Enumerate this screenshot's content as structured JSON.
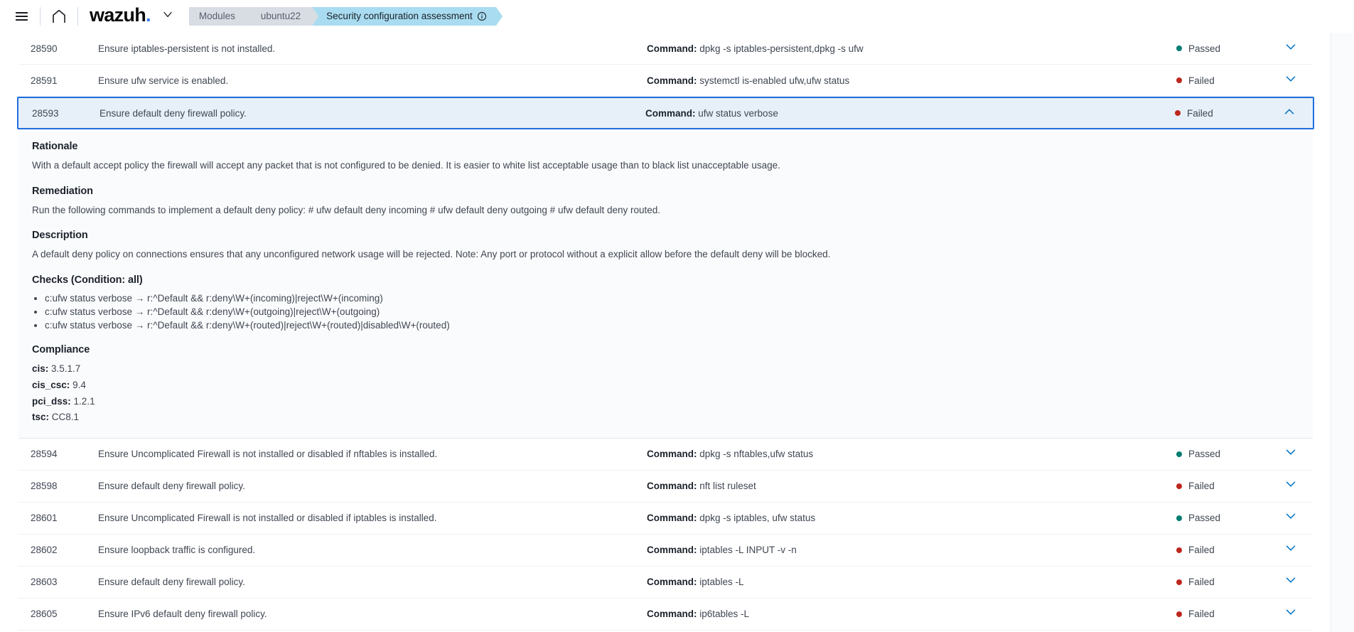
{
  "header": {
    "menu_icon": "hamburger-menu-icon",
    "home_icon": "home-icon",
    "brand": "wazuh",
    "brand_dot": ".",
    "brand_caret_icon": "chevron-down-icon",
    "breadcrumbs": [
      {
        "label": "Modules",
        "active": false
      },
      {
        "label": "ubuntu22",
        "active": false
      },
      {
        "label": "Security configuration assessment",
        "active": true,
        "info_icon": "info-circle-icon"
      }
    ]
  },
  "colors": {
    "passed": "#017d73",
    "failed": "#bd271e",
    "selected_border": "#1f6fde",
    "selected_bg": "#e7f0f8",
    "breadcrumb_active_bg": "#a9dcf0",
    "brand_dot": "#2f7ded",
    "caret": "#0071c2"
  },
  "table": {
    "command_label": "Command:",
    "rows": [
      {
        "id": "28590",
        "title": "Ensure iptables-persistent is not installed.",
        "command": "dpkg -s iptables-persistent,dpkg -s ufw",
        "status": "Passed",
        "expanded": false
      },
      {
        "id": "28591",
        "title": "Ensure ufw service is enabled.",
        "command": "systemctl is-enabled ufw,ufw status",
        "status": "Failed",
        "expanded": false
      },
      {
        "id": "28593",
        "title": "Ensure default deny firewall policy.",
        "command": "ufw status verbose",
        "status": "Failed",
        "expanded": true
      },
      {
        "id": "28594",
        "title": "Ensure Uncomplicated Firewall is not installed or disabled if nftables is installed.",
        "command": "dpkg -s nftables,ufw status",
        "status": "Passed",
        "expanded": false
      },
      {
        "id": "28598",
        "title": "Ensure default deny firewall policy.",
        "command": "nft list ruleset",
        "status": "Failed",
        "expanded": false
      },
      {
        "id": "28601",
        "title": "Ensure Uncomplicated Firewall is not installed or disabled if iptables is installed.",
        "command": "dpkg -s iptables, ufw status",
        "status": "Passed",
        "expanded": false
      },
      {
        "id": "28602",
        "title": "Ensure loopback traffic is configured.",
        "command": "iptables -L INPUT -v -n",
        "status": "Failed",
        "expanded": false
      },
      {
        "id": "28603",
        "title": "Ensure default deny firewall policy.",
        "command": "iptables -L",
        "status": "Failed",
        "expanded": false
      },
      {
        "id": "28605",
        "title": "Ensure IPv6 default deny firewall policy.",
        "command": "ip6tables -L",
        "status": "Failed",
        "expanded": false
      }
    ]
  },
  "detail": {
    "rationale_heading": "Rationale",
    "rationale_text": "With a default accept policy the firewall will accept any packet that is not configured to be denied. It is easier to white list acceptable usage than to black list unacceptable usage.",
    "remediation_heading": "Remediation",
    "remediation_text": "Run the following commands to implement a default deny policy: # ufw default deny incoming # ufw default deny outgoing # ufw default deny routed.",
    "description_heading": "Description",
    "description_text": "A default deny policy on connections ensures that any unconfigured network usage will be rejected. Note: Any port or protocol without a explicit allow before the default deny will be blocked.",
    "checks_heading": "Checks (Condition: all)",
    "checks": [
      "c:ufw status verbose → r:^Default && r:deny\\W+(incoming)|reject\\W+(incoming)",
      "c:ufw status verbose → r:^Default && r:deny\\W+(outgoing)|reject\\W+(outgoing)",
      "c:ufw status verbose → r:^Default && r:deny\\W+(routed)|reject\\W+(routed)|disabled\\W+(routed)"
    ],
    "compliance_heading": "Compliance",
    "compliance": [
      {
        "key": "cis:",
        "value": "3.5.1.7"
      },
      {
        "key": "cis_csc:",
        "value": "9.4"
      },
      {
        "key": "pci_dss:",
        "value": "1.2.1"
      },
      {
        "key": "tsc:",
        "value": "CC8.1"
      }
    ]
  }
}
